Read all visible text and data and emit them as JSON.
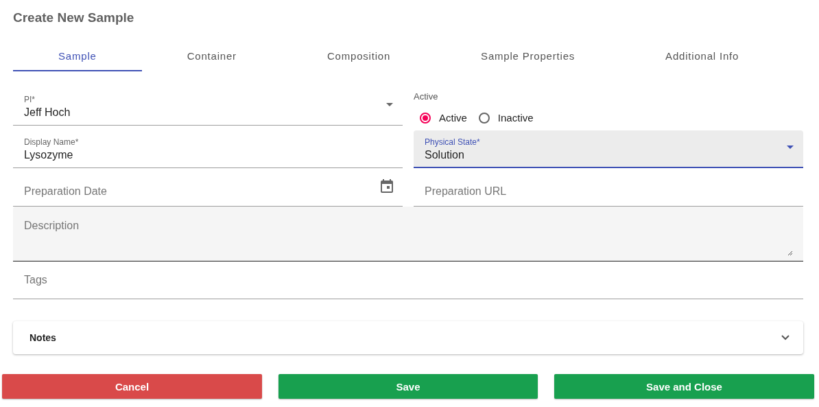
{
  "title": "Create New Sample",
  "tabs": [
    {
      "label": "Sample",
      "selected": true
    },
    {
      "label": "Container",
      "selected": false
    },
    {
      "label": "Composition",
      "selected": false
    },
    {
      "label": "Sample Properties",
      "selected": false
    },
    {
      "label": "Additional Info",
      "selected": false
    }
  ],
  "fields": [
    {
      "kind": "select",
      "label": "PI*",
      "value": "Jeff Hoch",
      "focused": false
    },
    {
      "kind": "radio-group",
      "label": "Active",
      "options": [
        {
          "label": "Active",
          "selected": true
        },
        {
          "label": "Inactive",
          "selected": false
        }
      ]
    },
    {
      "kind": "text",
      "label": "Display Name*",
      "value": "Lysozyme",
      "focused": false
    },
    {
      "kind": "select",
      "label": "Physical State*",
      "value": "Solution",
      "focused": true
    },
    {
      "kind": "date",
      "placeholder": "Preparation Date",
      "focused": false
    },
    {
      "kind": "text",
      "placeholder": "Preparation URL",
      "focused": false
    },
    {
      "kind": "textarea",
      "placeholder": "Description",
      "focused": false
    },
    {
      "kind": "tags",
      "placeholder": "Tags",
      "focused": false
    }
  ],
  "notes": {
    "label": "Notes",
    "expanded": false
  },
  "buttons": [
    {
      "label": "Cancel",
      "kind": "danger"
    },
    {
      "label": "Save",
      "kind": "primary"
    },
    {
      "label": "Save and Close",
      "kind": "primary"
    }
  ]
}
